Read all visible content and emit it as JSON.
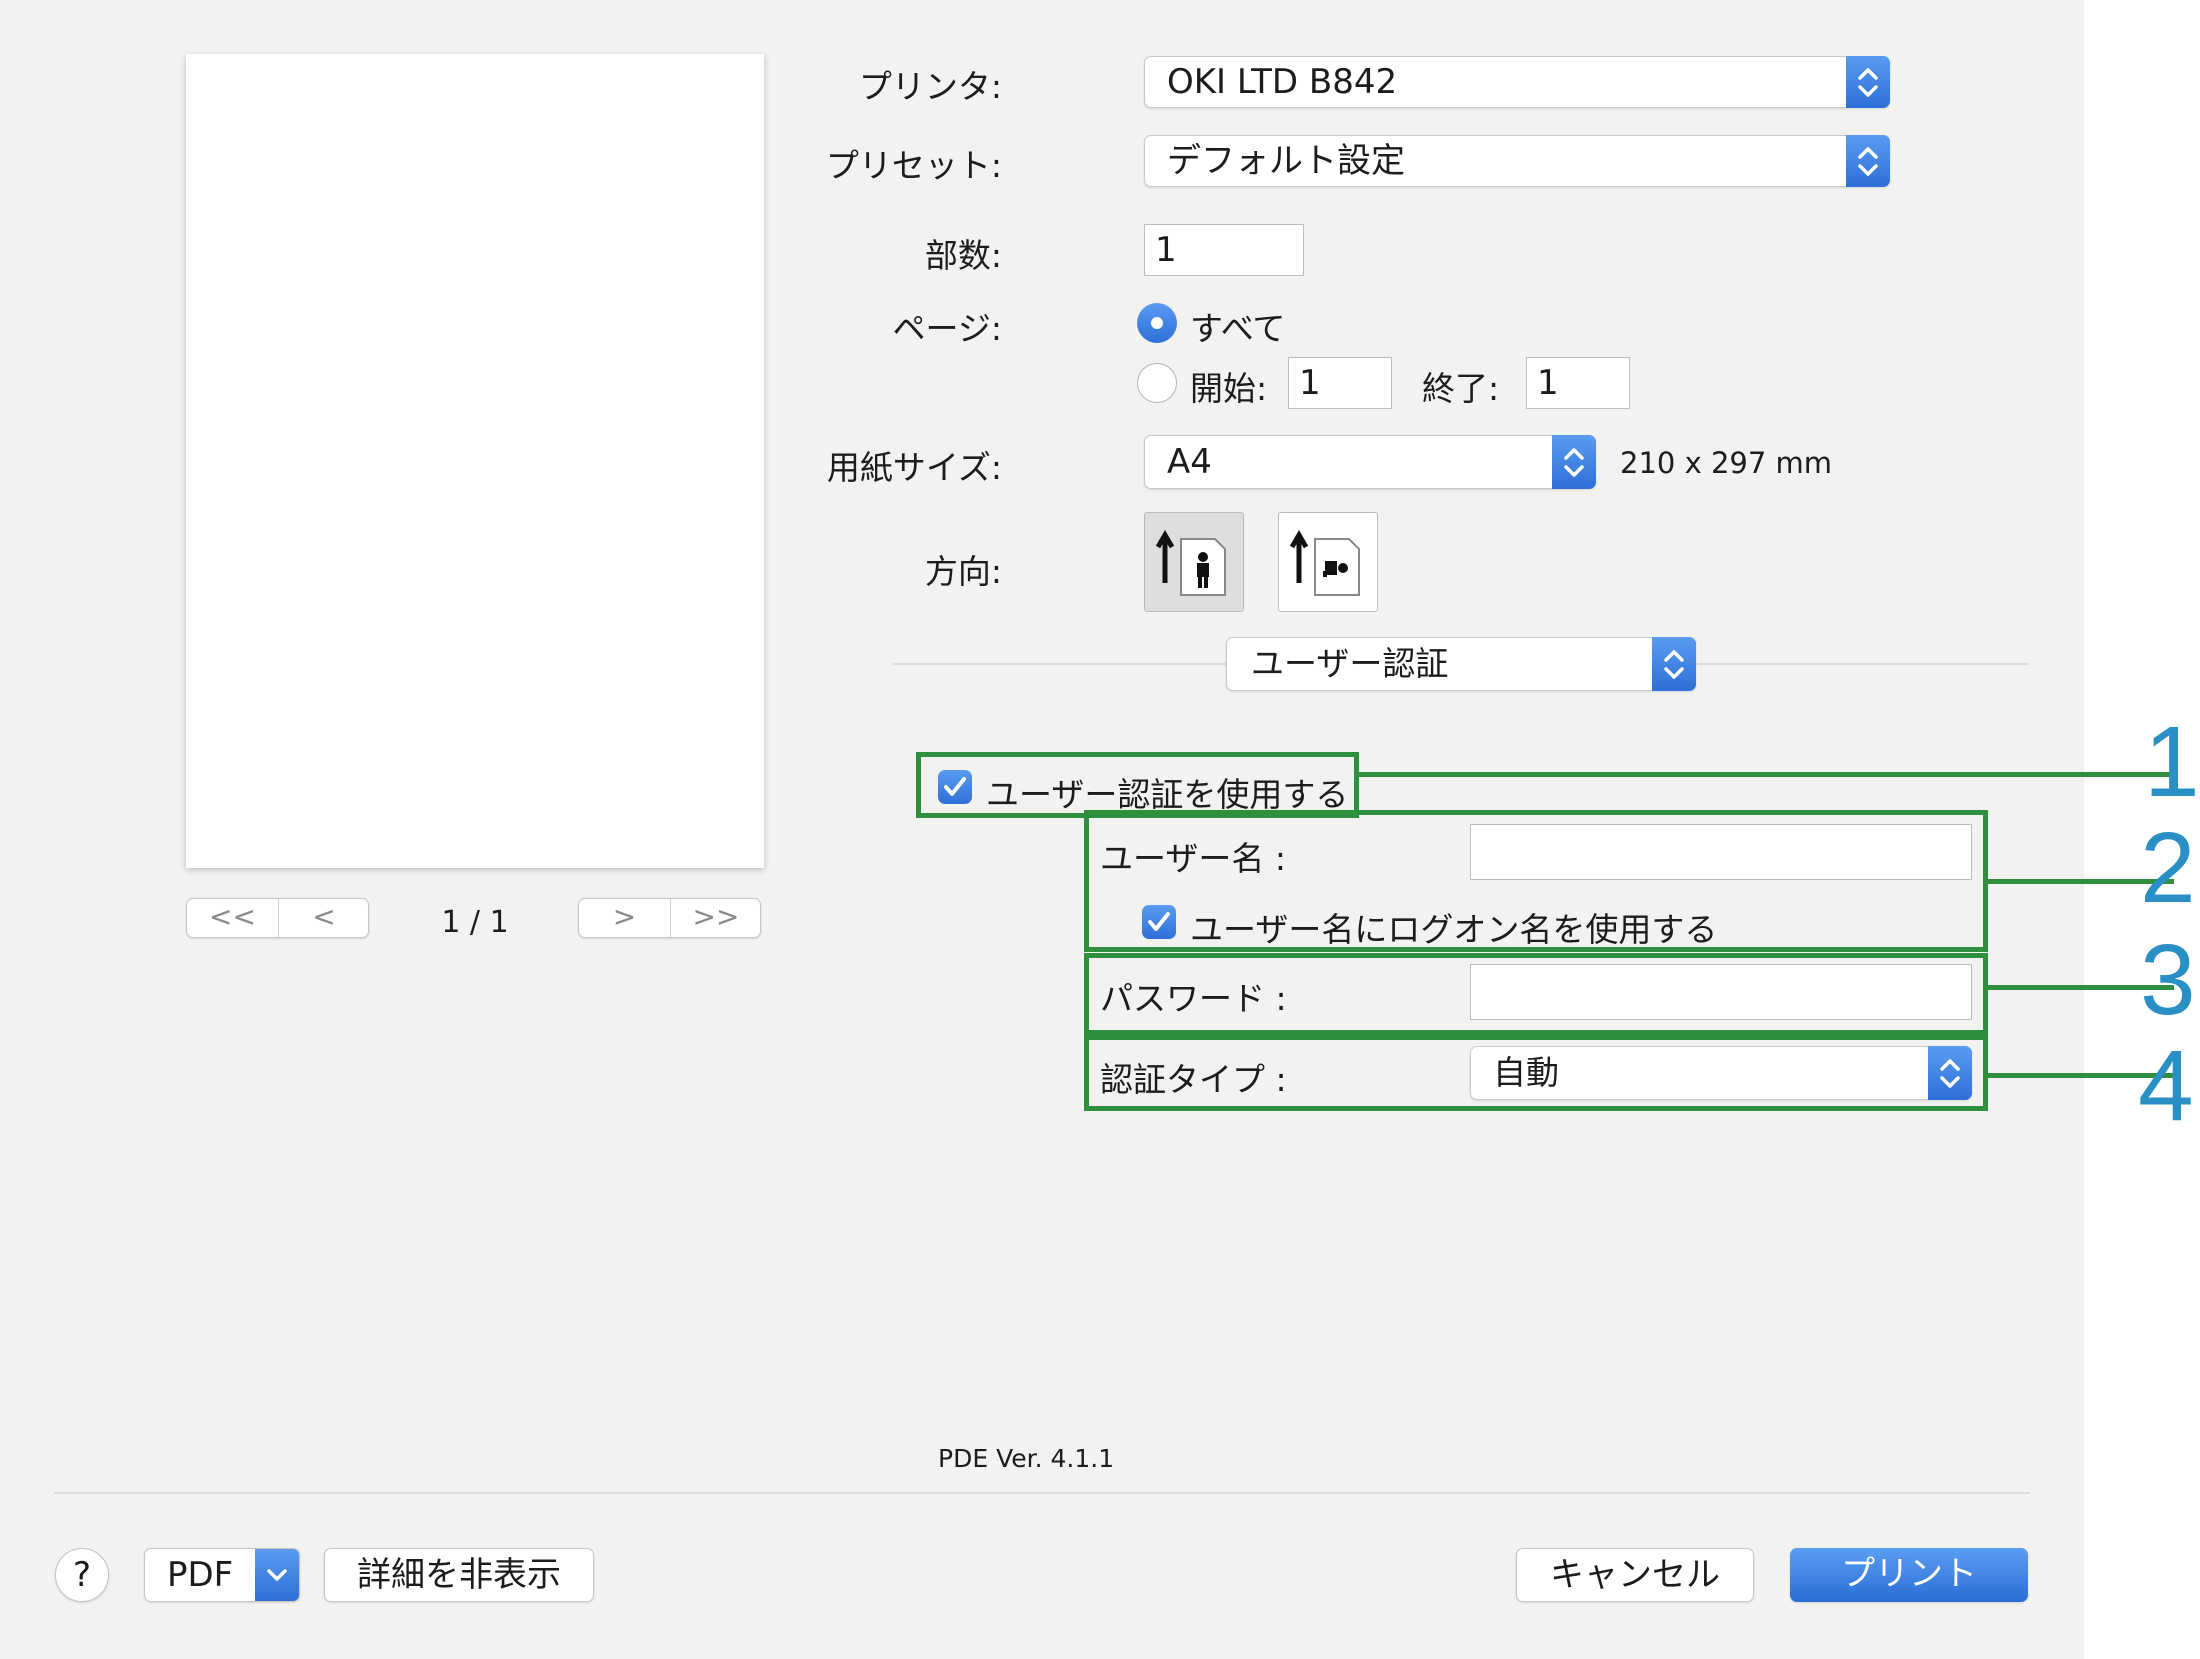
{
  "preview": {
    "page_indicator": "1 / 1",
    "nav_first": "<<",
    "nav_prev": "<",
    "nav_next": ">",
    "nav_last": ">>"
  },
  "printer": {
    "label": "プリンタ:",
    "value": "OKI LTD B842"
  },
  "preset": {
    "label": "プリセット:",
    "value": "デフォルト設定"
  },
  "copies": {
    "label": "部数:",
    "value": "1"
  },
  "pages": {
    "label": "ページ:",
    "all_label": "すべて",
    "all_selected": true,
    "from_label": "開始:",
    "from_value": "1",
    "to_label": "終了:",
    "to_value": "1"
  },
  "paper_size": {
    "label": "用紙サイズ:",
    "value": "A4",
    "dimensions": "210 x 297 mm"
  },
  "orientation": {
    "label": "方向:",
    "options": [
      "portrait",
      "landscape"
    ],
    "selected": "portrait"
  },
  "panel_selector": {
    "value": "ユーザー認証"
  },
  "auth": {
    "use_auth_label": "ユーザー認証を使用する",
    "use_auth_checked": true,
    "username_label": "ユーザー名 :",
    "username_value": "",
    "use_logon_label": "ユーザー名にログオン名を使用する",
    "use_logon_checked": true,
    "password_label": "パスワード :",
    "password_value": "",
    "auth_type_label": "認証タイプ :",
    "auth_type_value": "自動"
  },
  "callouts": [
    "1",
    "2",
    "3",
    "4"
  ],
  "version": "PDE Ver. 4.1.1",
  "footer": {
    "help": "?",
    "pdf": "PDF",
    "hide_details": "詳細を非表示",
    "cancel": "キャンセル",
    "print": "プリント"
  },
  "colors": {
    "accent_blue": "#2d6fd6",
    "callout_green": "#2e8f3e",
    "callout_number_blue": "#2a8fc4",
    "dialog_bg": "#f2f2f1"
  }
}
